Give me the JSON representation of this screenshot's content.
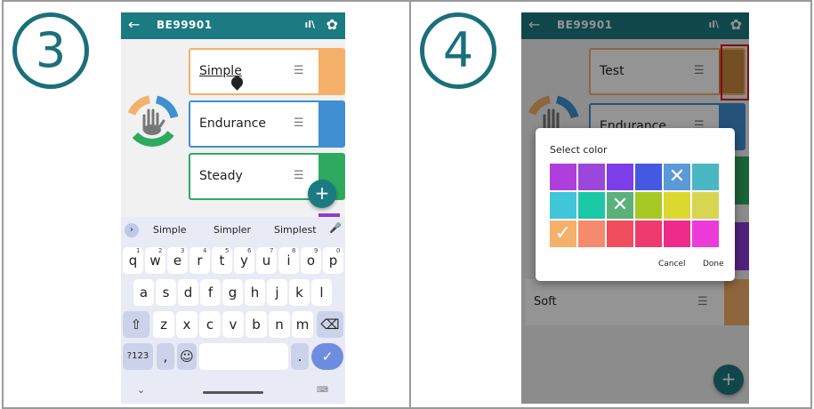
{
  "panels": {
    "left": {
      "step": "3",
      "app": {
        "title": "BE99901",
        "back_icon": "←",
        "library_icon": "ıl\\",
        "settings_icon": "✿"
      },
      "cards": [
        {
          "label": "Simple",
          "color": "#f5b06a"
        },
        {
          "label": "Endurance",
          "color": "#3f8fd2"
        },
        {
          "label": "Steady",
          "color": "#2eaa5f"
        }
      ],
      "fab": "+",
      "keyboard": {
        "suggestions": [
          "Simple",
          "Simpler",
          "Simplest"
        ],
        "row1": [
          "q",
          "w",
          "e",
          "r",
          "t",
          "y",
          "u",
          "i",
          "o",
          "p"
        ],
        "row1_nums": [
          "1",
          "2",
          "3",
          "4",
          "5",
          "6",
          "7",
          "8",
          "9",
          "0"
        ],
        "row2": [
          "a",
          "s",
          "d",
          "f",
          "g",
          "h",
          "j",
          "k",
          "l"
        ],
        "row3": [
          "z",
          "x",
          "c",
          "v",
          "b",
          "n",
          "m"
        ],
        "shift": "⇧",
        "backspace": "⌫",
        "symbols": "?123",
        "comma": ",",
        "emoji": "☺",
        "period": ".",
        "enter": "✓",
        "mic": "🎤",
        "hide": "⌄",
        "kb_switch": "⌨"
      }
    },
    "right": {
      "step": "4",
      "app": {
        "title": "BE99901",
        "back_icon": "←",
        "library_icon": "ıl\\",
        "settings_icon": "✿"
      },
      "cards": [
        {
          "label": "Test",
          "color": "#b07c43"
        },
        {
          "label": "Endurance",
          "color": "#2a6a9e"
        }
      ],
      "soft_label": "Soft",
      "fab": "+",
      "dialog": {
        "title": "Select color",
        "cancel": "Cancel",
        "done": "Done",
        "swatches": [
          "#ae3fdb",
          "#9b47db",
          "#7c3ee8",
          "#4459e0",
          "#5a9ad8",
          "#4ab8c2",
          "#40c6d8",
          "#1bc8a6",
          "#5ab27a",
          "#a6c924",
          "#dcd830",
          "#d6d650",
          "#f5b06a",
          "#f58a6c",
          "#f04e5c",
          "#ee3b6e",
          "#ee2a8a",
          "#ec3bd9"
        ]
      }
    }
  }
}
